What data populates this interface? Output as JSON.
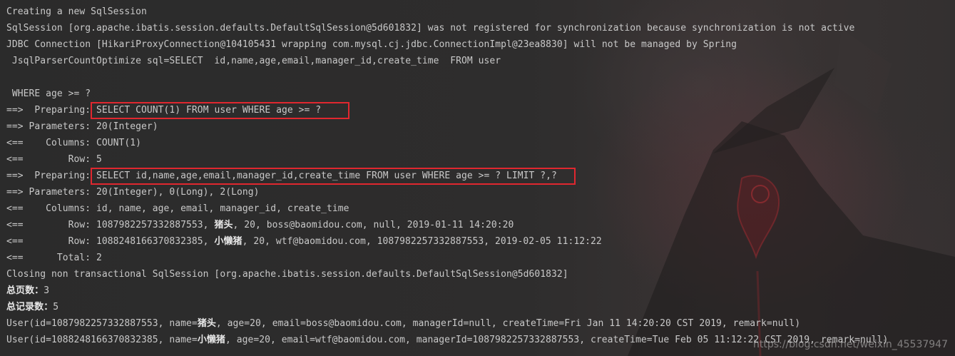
{
  "console": {
    "lines": [
      {
        "text": "Creating a new SqlSession"
      },
      {
        "text": "SqlSession [org.apache.ibatis.session.defaults.DefaultSqlSession@5d601832] was not registered for synchronization because synchronization is not active"
      },
      {
        "text": "JDBC Connection [HikariProxyConnection@104105431 wrapping com.mysql.cj.jdbc.ConnectionImpl@23ea8830] will not be managed by Spring"
      },
      {
        "text": " JsqlParserCountOptimize sql=SELECT  id,name,age,email,manager_id,create_time  FROM user"
      },
      {
        "text": ""
      },
      {
        "text": " WHERE age >= ?"
      },
      {
        "prefix": "==>  Preparing: ",
        "highlight": "SELECT COUNT(1) FROM user WHERE age >= ?"
      },
      {
        "text": "==> Parameters: 20(Integer)"
      },
      {
        "text": "<==    Columns: COUNT(1)"
      },
      {
        "text": "<==        Row: 5"
      },
      {
        "prefix": "==>  Preparing: ",
        "highlight": "SELECT id,name,age,email,manager_id,create_time FROM user WHERE age >= ? LIMIT ?,?"
      },
      {
        "text": "==> Parameters: 20(Integer), 0(Long), 2(Long)"
      },
      {
        "text": "<==    Columns: id, name, age, email, manager_id, create_time"
      },
      {
        "pre": "<==        Row: 1087982257332887553, ",
        "cjk": "猪头",
        "post": ", 20, boss@baomidou.com, null, 2019-01-11 14:20:20"
      },
      {
        "pre": "<==        Row: 1088248166370832385, ",
        "cjk": "小懒猪",
        "post": ", 20, wtf@baomidou.com, 1087982257332887553, 2019-02-05 11:12:22"
      },
      {
        "text": "<==      Total: 2"
      },
      {
        "text": "Closing non transactional SqlSession [org.apache.ibatis.session.defaults.DefaultSqlSession@5d601832]"
      },
      {
        "cjk": "总页数：",
        "post": "3"
      },
      {
        "cjk": "总记录数：",
        "post": "5"
      },
      {
        "pre": "User(id=1087982257332887553, name=",
        "cjk": "猪头",
        "post": ", age=20, email=boss@baomidou.com, managerId=null, createTime=Fri Jan 11 14:20:20 CST 2019, remark=null)"
      },
      {
        "pre": "User(id=1088248166370832385, name=",
        "cjk": "小懒猪",
        "post": ", age=20, email=wtf@baomidou.com, managerId=1087982257332887553, createTime=Tue Feb 05 11:12:22 CST 2019, remark=null)"
      }
    ]
  },
  "watermark": "https://blog.csdn.net/weixin_45537947",
  "colors": {
    "text": "#c9c9c9",
    "highlight_border": "#e0272f",
    "background": "#2e2d2d"
  }
}
